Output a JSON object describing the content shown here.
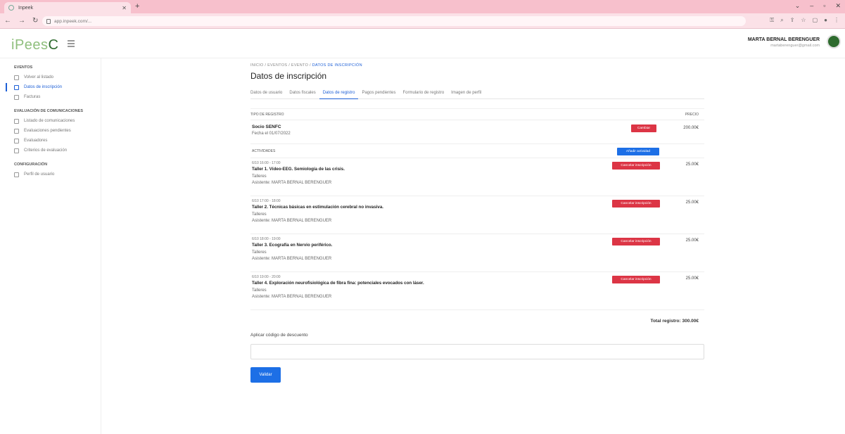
{
  "browser": {
    "tab_title": "Inpeek",
    "url": "app.inpeek.com/..."
  },
  "header": {
    "logo_text": "iPees",
    "logo_mark": "C",
    "user_name": "MARTA BERNAL BERENGUER",
    "user_email": "martaberenguer@gmail.com"
  },
  "sidebar": {
    "sections": [
      {
        "title": "EVENTOS",
        "items": [
          {
            "label": "Volver al listado",
            "icon": "back-arrow-icon"
          },
          {
            "label": "Datos de inscripción",
            "icon": "document-icon",
            "active": true
          },
          {
            "label": "Facturas",
            "icon": "invoice-icon"
          }
        ]
      },
      {
        "title": "EVALUACIÓN DE COMUNICACIONES",
        "items": [
          {
            "label": "Listado de comunicaciones",
            "icon": "download-icon"
          },
          {
            "label": "Evaluaciones pendientes",
            "icon": "monitor-icon"
          },
          {
            "label": "Evaluadores",
            "icon": "circle-icon"
          },
          {
            "label": "Criterios de evaluación",
            "icon": "circle-icon"
          }
        ]
      },
      {
        "title": "CONFIGURACIÓN",
        "items": [
          {
            "label": "Perfil de usuario",
            "icon": "user-icon"
          }
        ]
      }
    ]
  },
  "main": {
    "breadcrumb": [
      "INICIO",
      "EVENTOS",
      "EVENTO"
    ],
    "breadcrumb_current": "DATOS DE INSCRIPCIÓN",
    "title": "Datos de inscripción",
    "tabs": [
      "Datos de usuario",
      "Datos fiscales",
      "Datos de registro",
      "Pagos pendientes",
      "Formulario de registro",
      "Imagen de perfil"
    ],
    "active_tab": 2,
    "table": {
      "col_type": "TIPO DE REGISTRO",
      "col_price": "PRECIO",
      "registration": {
        "name": "Socio SENFC",
        "date": "Fecha el 01/07/2022",
        "badge": "Cambiar",
        "price": "200.00€"
      },
      "activities_label": "ACTIVIDADES",
      "add_activity": "Añadir actividad",
      "activities": [
        {
          "time": "6/10 16:00 - 17:00",
          "title": "Taller 1. Vídeo-EEG. Semiología de las crisis.",
          "category": "Talleres",
          "person": "Asistente: MARTA BERNAL BERENGUER",
          "cancel": "Cancelar inscripción",
          "price": "25.00€"
        },
        {
          "time": "6/10 17:00 - 18:00",
          "title": "Taller 2. Técnicas básicas en estimulación cerebral no invasiva.",
          "category": "Talleres",
          "person": "Asistente: MARTA BERNAL BERENGUER",
          "cancel": "Cancelar inscripción",
          "price": "25.00€"
        },
        {
          "time": "6/10 18:00 - 19:00",
          "title": "Taller 3. Ecografía en Nervio periférico.",
          "category": "Talleres",
          "person": "Asistente: MARTA BERNAL BERENGUER",
          "cancel": "Cancelar inscripción",
          "price": "25.00€"
        },
        {
          "time": "6/10 19:00 - 20:00",
          "title": "Taller 4. Exploración neurofisiológica de fibra fina: potenciales evocados con láser.",
          "category": "Talleres",
          "person": "Asistente: MARTA BERNAL BERENGUER",
          "cancel": "Cancelar inscripción",
          "price": "25.00€"
        }
      ],
      "total": "Total registro: 300.00€"
    },
    "discount_label": "Aplicar código de descuento",
    "discount_value": "",
    "validate_label": "Validar"
  },
  "colors": {
    "primary": "#1d6fe6",
    "danger": "#dc3545",
    "brand_green": "#8fbf7d",
    "chrome_pink": "#f7c0cc"
  }
}
